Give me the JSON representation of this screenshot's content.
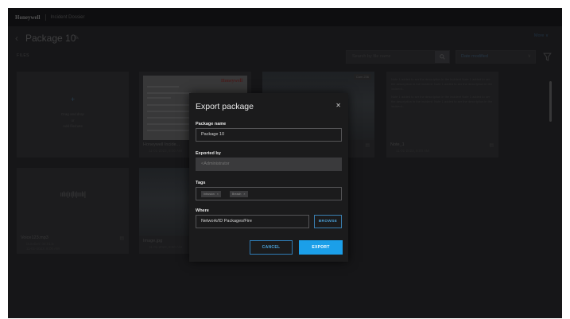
{
  "topbar": {
    "brand": "Honeywell",
    "product": "Incident Dossier"
  },
  "header": {
    "title": "Package 10",
    "more_label": "More ∨"
  },
  "files_label": "FILES",
  "search": {
    "placeholder": "Search by file name"
  },
  "sort": {
    "value": "Date modified"
  },
  "tiles": {
    "add": {
      "plus": "+",
      "line1": "Drag and drop",
      "line2": "or",
      "line3": "Add file/note"
    },
    "report": {
      "name": "Honeywell Incide...",
      "date": "11-01-2023, 8:00 AM",
      "logo": "Honeywell"
    },
    "photo1": {
      "badge": "Cam 236"
    },
    "note": {
      "name": "Note_1",
      "date": "11-01-2023, 8:00 AM",
      "text1": "Note 1 added to ser the description in the incident Note 1 added to ser the description in the incident. Note 1 added to ser the description in the incident..",
      "text2": "Note 1 added to ser the description in the incident Note 1 added to ser the description in the incident. Note 1 added to ser the description in the incident.."
    },
    "voice": {
      "name": "Voice123.mp3",
      "meta1": "Duration: 00:01:5",
      "meta2": "11-01-2023, 8:00 AM"
    },
    "image": {
      "name": "Image.jpg",
      "date": "11-01-2023, 8:00 AM"
    }
  },
  "modal": {
    "title": "Export package",
    "package_name_label": "Package name",
    "package_name_value": "Package 10",
    "exported_by_label": "Exported by",
    "exported_by_value": "<Administrator",
    "tags_label": "Tags",
    "tags": [
      "Intrusion",
      "Breach"
    ],
    "where_label": "Where",
    "where_value": "Network/ID Packages/Fire",
    "browse_label": "BROWSE",
    "cancel_label": "CANCEL",
    "export_label": "EXPORT"
  },
  "colors": {
    "accent": "#1b9fe9",
    "link": "#4ba1d9",
    "background": "#1f1f21",
    "modal": "#1b1b1c"
  }
}
